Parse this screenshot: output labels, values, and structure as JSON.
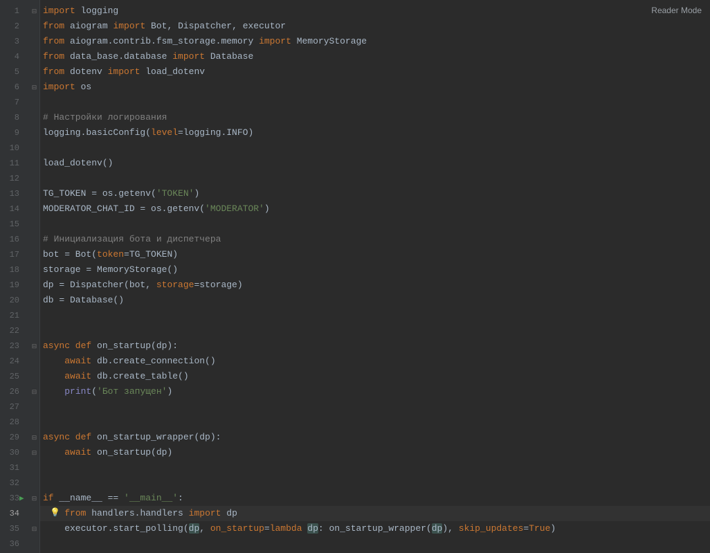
{
  "readerMode": "Reader Mode",
  "lines": {
    "1": {
      "t": [
        {
          "c": "kw",
          "s": "import"
        },
        {
          "c": "id",
          "s": " logging"
        }
      ]
    },
    "2": {
      "t": [
        {
          "c": "kw",
          "s": "from"
        },
        {
          "c": "id",
          "s": " aiogram "
        },
        {
          "c": "kw",
          "s": "import"
        },
        {
          "c": "id",
          "s": " Bot"
        },
        {
          "c": "punc",
          "s": ", "
        },
        {
          "c": "id",
          "s": "Dispatcher"
        },
        {
          "c": "punc",
          "s": ", "
        },
        {
          "c": "id",
          "s": "executor"
        }
      ]
    },
    "3": {
      "t": [
        {
          "c": "kw",
          "s": "from"
        },
        {
          "c": "id",
          "s": " aiogram.contrib.fsm_storage.memory "
        },
        {
          "c": "kw",
          "s": "import"
        },
        {
          "c": "id",
          "s": " MemoryStorage"
        }
      ]
    },
    "4": {
      "t": [
        {
          "c": "kw",
          "s": "from"
        },
        {
          "c": "id",
          "s": " data_base.database "
        },
        {
          "c": "kw",
          "s": "import"
        },
        {
          "c": "id",
          "s": " Database"
        }
      ]
    },
    "5": {
      "t": [
        {
          "c": "kw",
          "s": "from"
        },
        {
          "c": "id",
          "s": " dotenv "
        },
        {
          "c": "kw",
          "s": "import"
        },
        {
          "c": "id",
          "s": " load_dotenv"
        }
      ]
    },
    "6": {
      "t": [
        {
          "c": "kw",
          "s": "import"
        },
        {
          "c": "id",
          "s": " os"
        }
      ]
    },
    "7": {
      "t": []
    },
    "8": {
      "t": [
        {
          "c": "cm",
          "s": "# Настройки логирования"
        }
      ]
    },
    "9": {
      "t": [
        {
          "c": "id",
          "s": "logging.basicConfig("
        },
        {
          "c": "param",
          "s": "level"
        },
        {
          "c": "id",
          "s": "=logging.INFO)"
        }
      ]
    },
    "10": {
      "t": []
    },
    "11": {
      "t": [
        {
          "c": "id",
          "s": "load_dotenv()"
        }
      ]
    },
    "12": {
      "t": []
    },
    "13": {
      "t": [
        {
          "c": "id",
          "s": "TG_TOKEN = os.getenv("
        },
        {
          "c": "str",
          "s": "'TOKEN'"
        },
        {
          "c": "id",
          "s": ")"
        }
      ]
    },
    "14": {
      "t": [
        {
          "c": "id",
          "s": "MODERATOR_CHAT_ID = os.getenv("
        },
        {
          "c": "str",
          "s": "'MODERATOR'"
        },
        {
          "c": "id",
          "s": ")"
        }
      ]
    },
    "15": {
      "t": []
    },
    "16": {
      "t": [
        {
          "c": "cm",
          "s": "# Инициализация бота и диспетчера"
        }
      ]
    },
    "17": {
      "t": [
        {
          "c": "id",
          "s": "bot = Bot("
        },
        {
          "c": "param",
          "s": "token"
        },
        {
          "c": "id",
          "s": "=TG_TOKEN)"
        }
      ]
    },
    "18": {
      "t": [
        {
          "c": "id",
          "s": "storage = MemoryStorage()"
        }
      ]
    },
    "19": {
      "t": [
        {
          "c": "id",
          "s": "dp = Dispatcher(bot"
        },
        {
          "c": "punc",
          "s": ", "
        },
        {
          "c": "param",
          "s": "storage"
        },
        {
          "c": "id",
          "s": "=storage)"
        }
      ]
    },
    "20": {
      "t": [
        {
          "c": "id",
          "s": "db = Database()"
        }
      ]
    },
    "21": {
      "t": []
    },
    "22": {
      "t": []
    },
    "23": {
      "t": [
        {
          "c": "kw",
          "s": "async def "
        },
        {
          "c": "id",
          "s": "on_startup(dp):"
        }
      ]
    },
    "24": {
      "t": [
        {
          "c": "id",
          "s": "    "
        },
        {
          "c": "kw",
          "s": "await"
        },
        {
          "c": "id",
          "s": " db.create_connection()"
        }
      ]
    },
    "25": {
      "t": [
        {
          "c": "id",
          "s": "    "
        },
        {
          "c": "kw",
          "s": "await"
        },
        {
          "c": "id",
          "s": " db.create_table()"
        }
      ]
    },
    "26": {
      "t": [
        {
          "c": "id",
          "s": "    "
        },
        {
          "c": "builtin",
          "s": "print"
        },
        {
          "c": "id",
          "s": "("
        },
        {
          "c": "str",
          "s": "'Бот запущен'"
        },
        {
          "c": "id",
          "s": ")"
        }
      ]
    },
    "27": {
      "t": []
    },
    "28": {
      "t": []
    },
    "29": {
      "t": [
        {
          "c": "kw",
          "s": "async def "
        },
        {
          "c": "id",
          "s": "on_startup_wrapper(dp):"
        }
      ]
    },
    "30": {
      "t": [
        {
          "c": "id",
          "s": "    "
        },
        {
          "c": "kw",
          "s": "await"
        },
        {
          "c": "id",
          "s": " on_startup(dp)"
        }
      ]
    },
    "31": {
      "t": []
    },
    "32": {
      "t": []
    },
    "33": {
      "t": [
        {
          "c": "kw",
          "s": "if "
        },
        {
          "c": "id",
          "s": "__name__ == "
        },
        {
          "c": "str",
          "s": "'__main__'"
        },
        {
          "c": "id",
          "s": ":"
        }
      ]
    },
    "34": {
      "t": [
        {
          "c": "id",
          "s": "    "
        },
        {
          "c": "kw",
          "s": "from"
        },
        {
          "c": "id",
          "s": " handlers.handlers "
        },
        {
          "c": "kw",
          "s": "import"
        },
        {
          "c": "id",
          "s": " dp"
        }
      ]
    },
    "35": {
      "t": [
        {
          "c": "id",
          "s": "    executor.start_polling("
        },
        {
          "c": "dp-hl",
          "s": "dp"
        },
        {
          "c": "punc",
          "s": ", "
        },
        {
          "c": "param",
          "s": "on_startup"
        },
        {
          "c": "id",
          "s": "="
        },
        {
          "c": "kw",
          "s": "lambda "
        },
        {
          "c": "dp-hl",
          "s": "dp"
        },
        {
          "c": "id",
          "s": ": on_startup_wrapper("
        },
        {
          "c": "dp-hl",
          "s": "dp"
        },
        {
          "c": "id",
          "s": ")"
        },
        {
          "c": "punc",
          "s": ", "
        },
        {
          "c": "param",
          "s": "skip_updates"
        },
        {
          "c": "id",
          "s": "="
        },
        {
          "c": "kw",
          "s": "True"
        },
        {
          "c": "id",
          "s": ")"
        }
      ]
    },
    "36": {
      "t": []
    }
  },
  "fold": {
    "1": "⊟",
    "2": "",
    "3": "",
    "4": "",
    "5": "",
    "6": "⊟",
    "7": "",
    "8": "",
    "9": "",
    "10": "",
    "11": "",
    "12": "",
    "13": "",
    "14": "",
    "15": "",
    "16": "",
    "17": "",
    "18": "",
    "19": "",
    "20": "",
    "21": "",
    "22": "",
    "23": "⊟",
    "24": "",
    "25": "",
    "26": "⊟",
    "27": "",
    "28": "",
    "29": "⊟",
    "30": "⊟",
    "31": "",
    "32": "",
    "33": "⊟",
    "34": "",
    "35": "⊟",
    "36": ""
  },
  "currentLine": 34,
  "runLine": 33,
  "totalLines": 36
}
